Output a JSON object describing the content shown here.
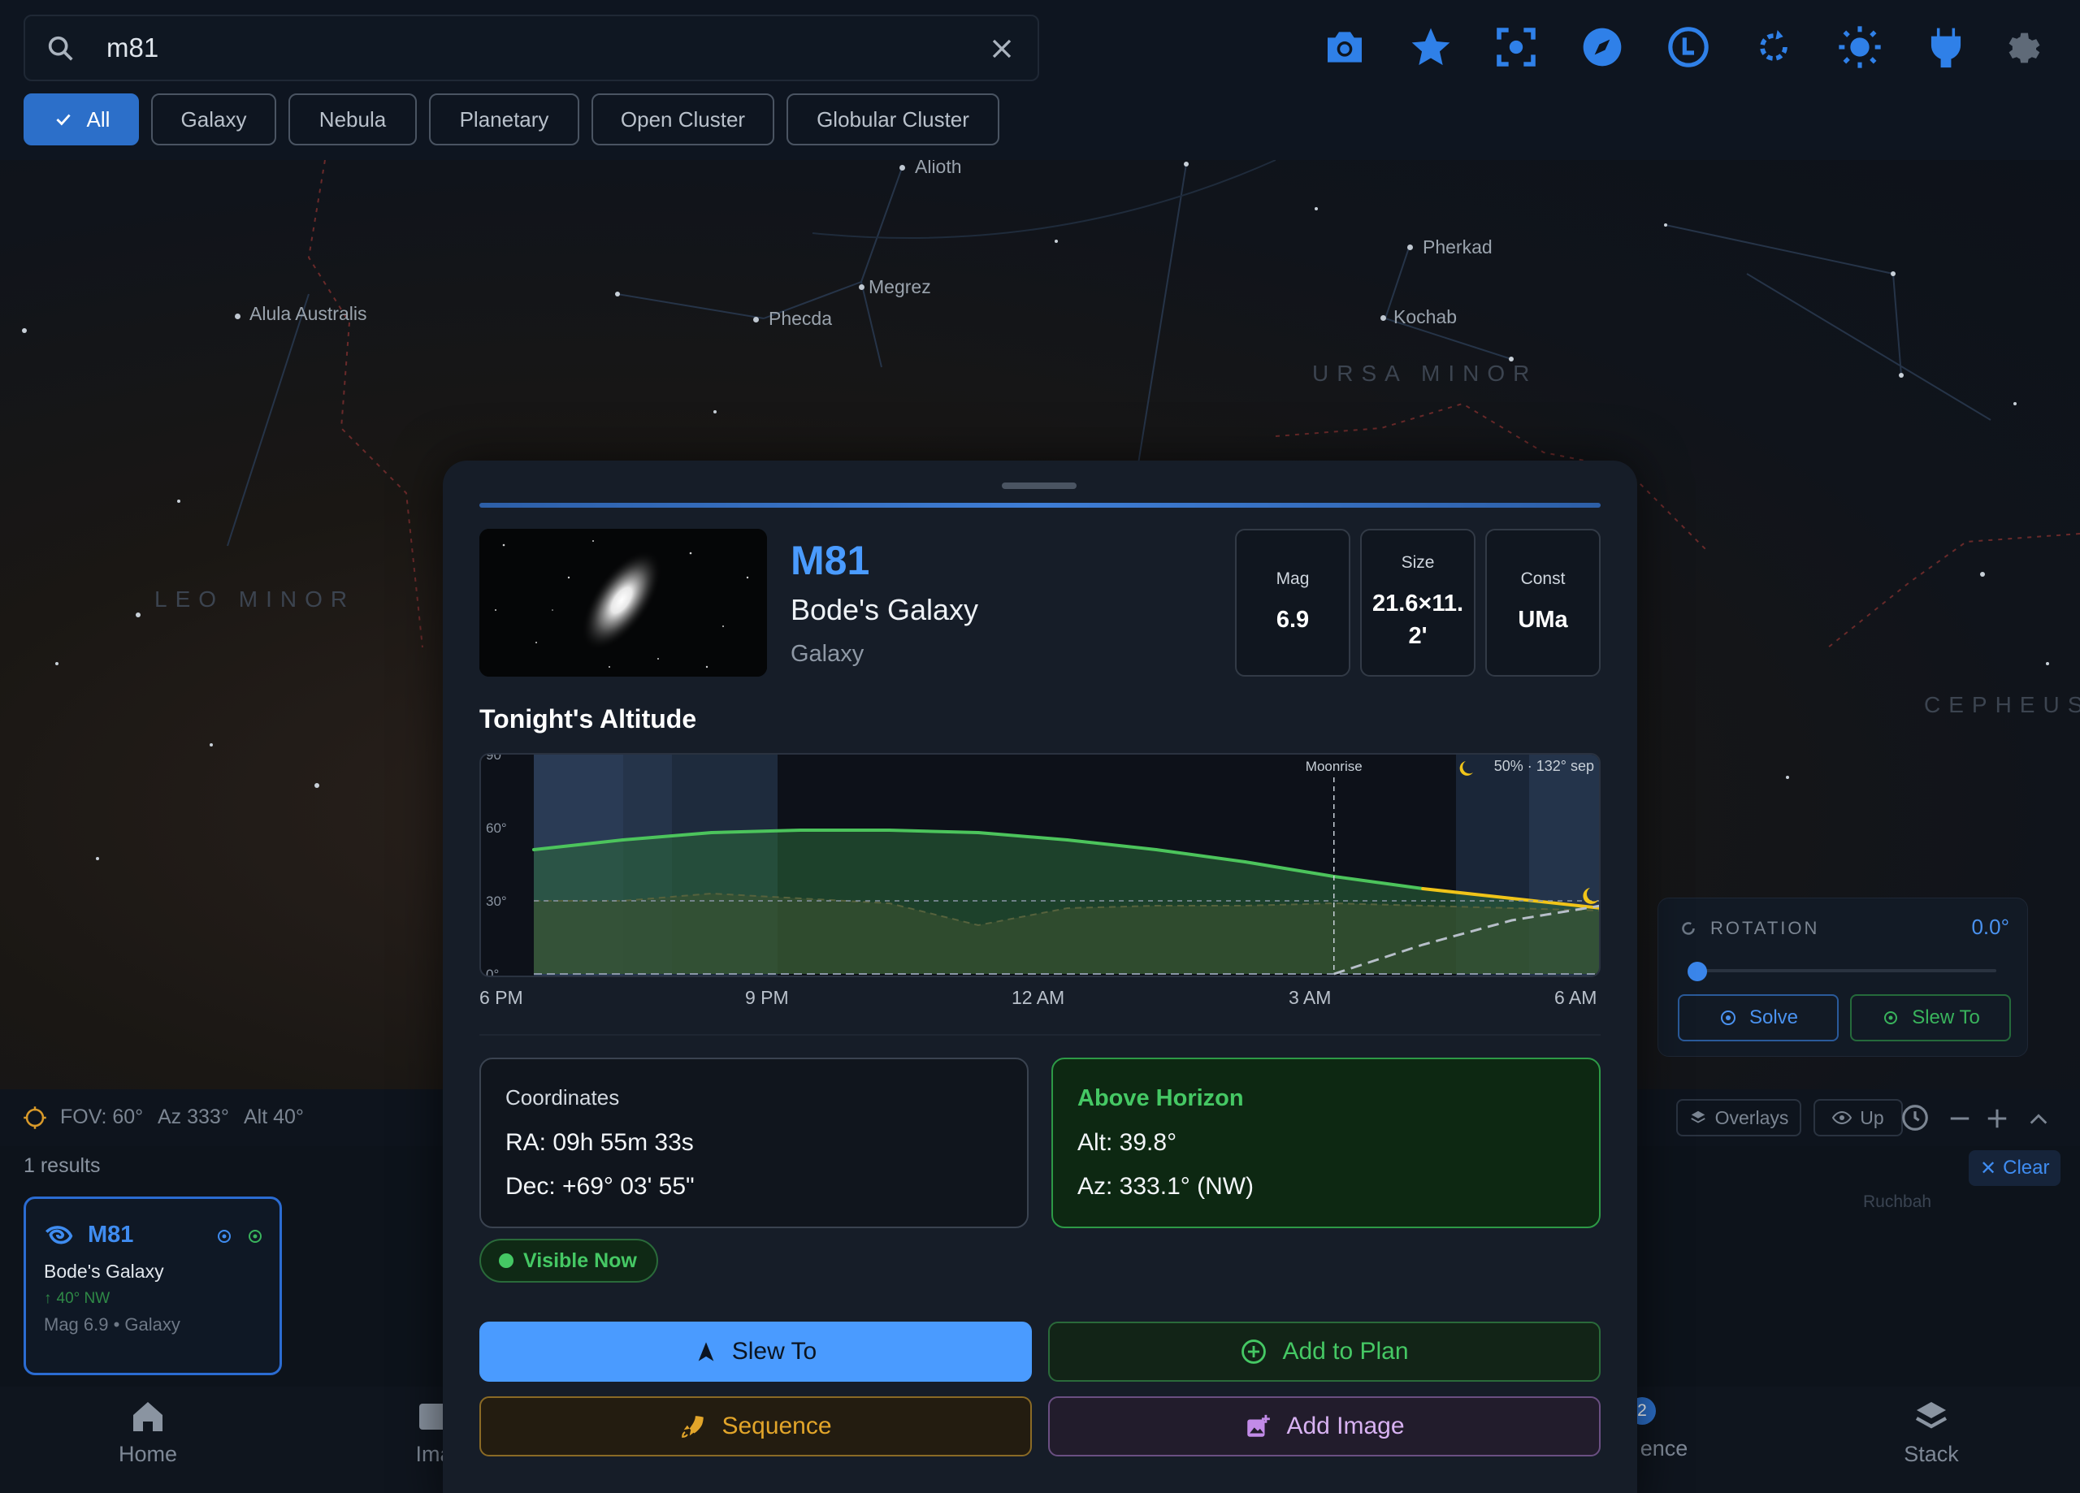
{
  "search": {
    "query": "m81"
  },
  "filters": [
    {
      "label": "All",
      "active": true
    },
    {
      "label": "Galaxy"
    },
    {
      "label": "Nebula"
    },
    {
      "label": "Planetary"
    },
    {
      "label": "Open Cluster"
    },
    {
      "label": "Globular Cluster"
    }
  ],
  "toolbar_icons": [
    "camera-icon",
    "star-icon",
    "focus-icon",
    "compass-icon",
    "clock-icon",
    "rotate-icon",
    "brightness-icon",
    "plug-icon",
    "gear-icon"
  ],
  "sky": {
    "stars": [
      "Alioth",
      "Pherkad",
      "Megrez",
      "Phecda",
      "Kochab",
      "Alula Australis",
      "Ruchbah"
    ],
    "constellations": [
      "URSA MINOR",
      "LEO MINOR",
      "CEPHEUS"
    ]
  },
  "rotation": {
    "label": "ROTATION",
    "value": "0.0°",
    "slider_fraction": 0.0,
    "solve": "Solve",
    "slew": "Slew To"
  },
  "status": {
    "fov": "FOV: 60°",
    "az": "Az 333°",
    "alt": "Alt 40°",
    "overlays": "Overlays",
    "up": "Up",
    "clear": "Clear"
  },
  "results": {
    "count": "1 results",
    "card": {
      "id": "M81",
      "name": "Bode's Galaxy",
      "position": "40° NW",
      "meta": "Mag 6.9 • Galaxy"
    }
  },
  "nav": {
    "home": "Home",
    "images": "Ima",
    "sequence": "ence",
    "stack": "Stack",
    "sequence_badge": "2"
  },
  "object": {
    "id": "M81",
    "name": "Bode's Galaxy",
    "type": "Galaxy",
    "stats": [
      {
        "label": "Mag",
        "value": "6.9"
      },
      {
        "label": "Size",
        "value": "21.6×11.\n2'"
      },
      {
        "label": "Const",
        "value": "UMa"
      }
    ]
  },
  "altitude": {
    "title": "Tonight's Altitude",
    "moonrise": "Moonrise",
    "moon_info": "50% · 132° sep",
    "yticks": [
      "90°",
      "60°",
      "30°",
      "0°"
    ],
    "xticks": [
      "6 PM",
      "9 PM",
      "12 AM",
      "3 AM",
      "6 AM"
    ]
  },
  "chart_data": {
    "type": "area",
    "x": [
      "6 PM",
      "7 PM",
      "8 PM",
      "9 PM",
      "10 PM",
      "11 PM",
      "12 AM",
      "1 AM",
      "2 AM",
      "3 AM",
      "4 AM",
      "5 AM",
      "6 AM"
    ],
    "ylim": [
      0,
      90
    ],
    "series": [
      {
        "values": [
          51,
          55,
          58,
          59,
          59,
          58,
          55,
          51,
          46,
          40,
          35,
          31,
          27
        ]
      },
      {
        "values": [
          30,
          30,
          33,
          31,
          29,
          20,
          27,
          28,
          28,
          29,
          28,
          27,
          26
        ]
      },
      {
        "values": [
          null,
          null,
          null,
          null,
          null,
          null,
          null,
          null,
          null,
          0,
          12,
          22,
          28
        ]
      }
    ],
    "yticks": [
      "90°",
      "60°",
      "30°",
      "0°"
    ],
    "xticks": [
      "6 PM",
      "9 PM",
      "12 AM",
      "3 AM",
      "6 AM"
    ],
    "annotations": [
      "Moonrise",
      "50% · 132° sep"
    ]
  },
  "coordinates": {
    "title": "Coordinates",
    "ra": "RA:  09h 55m 33s",
    "dec": "Dec: +69° 03' 55\""
  },
  "horizon": {
    "title": "Above Horizon",
    "alt": "Alt: 39.8°",
    "az": "Az: 333.1° (NW)"
  },
  "visible_badge": "Visible Now",
  "actions": {
    "slew": "Slew To",
    "plan": "Add to Plan",
    "sequence": "Sequence",
    "image": "Add Image"
  },
  "colors": {
    "accent": "#4a9bff",
    "green": "#3cc75a",
    "amber": "#e2a52a",
    "purple": "#c28be8"
  }
}
